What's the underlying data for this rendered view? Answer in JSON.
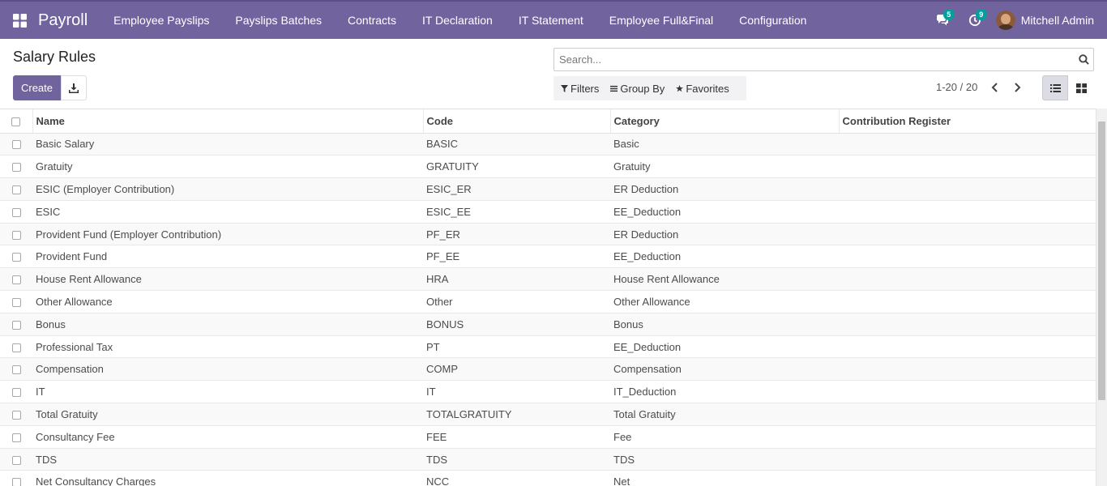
{
  "navbar": {
    "brand": "Payroll",
    "menu": [
      "Employee Payslips",
      "Payslips Batches",
      "Contracts",
      "IT Declaration",
      "IT Statement",
      "Employee Full&Final",
      "Configuration"
    ],
    "messages_count": "5",
    "activities_count": "9",
    "user_name": "Mitchell Admin"
  },
  "control": {
    "title": "Salary Rules",
    "create_label": "Create",
    "search_placeholder": "Search...",
    "filters_label": "Filters",
    "groupby_label": "Group By",
    "favorites_label": "Favorites",
    "pager_text": "1-20 / 20"
  },
  "table": {
    "columns": [
      "Name",
      "Code",
      "Category",
      "Contribution Register"
    ],
    "rows": [
      {
        "name": "Basic Salary",
        "code": "BASIC",
        "category": "Basic",
        "register": ""
      },
      {
        "name": "Gratuity",
        "code": "GRATUITY",
        "category": "Gratuity",
        "register": ""
      },
      {
        "name": "ESIC (Employer Contribution)",
        "code": "ESIC_ER",
        "category": "ER Deduction",
        "register": ""
      },
      {
        "name": "ESIC",
        "code": "ESIC_EE",
        "category": "EE_Deduction",
        "register": ""
      },
      {
        "name": "Provident Fund (Employer Contribution)",
        "code": "PF_ER",
        "category": "ER Deduction",
        "register": ""
      },
      {
        "name": "Provident Fund",
        "code": "PF_EE",
        "category": "EE_Deduction",
        "register": ""
      },
      {
        "name": "House Rent Allowance",
        "code": "HRA",
        "category": "House Rent Allowance",
        "register": ""
      },
      {
        "name": "Other Allowance",
        "code": "Other",
        "category": "Other Allowance",
        "register": ""
      },
      {
        "name": "Bonus",
        "code": "BONUS",
        "category": "Bonus",
        "register": ""
      },
      {
        "name": "Professional Tax",
        "code": "PT",
        "category": "EE_Deduction",
        "register": ""
      },
      {
        "name": "Compensation",
        "code": "COMP",
        "category": "Compensation",
        "register": ""
      },
      {
        "name": "IT",
        "code": "IT",
        "category": "IT_Deduction",
        "register": ""
      },
      {
        "name": "Total Gratuity",
        "code": "TOTALGRATUITY",
        "category": "Total Gratuity",
        "register": ""
      },
      {
        "name": "Consultancy Fee",
        "code": "FEE",
        "category": "Fee",
        "register": ""
      },
      {
        "name": "TDS",
        "code": "TDS",
        "category": "TDS",
        "register": ""
      },
      {
        "name": "Net Consultancy Charges",
        "code": "NCC",
        "category": "Net",
        "register": ""
      }
    ]
  },
  "colors": {
    "primary": "#71639e",
    "badge": "#00a09d"
  }
}
